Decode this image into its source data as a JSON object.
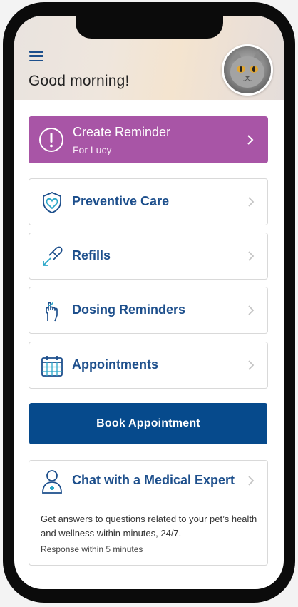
{
  "header": {
    "greeting": "Good morning!",
    "menu_icon": "hamburger-menu-icon",
    "avatar": "pet-avatar-cat"
  },
  "reminder": {
    "title": "Create Reminder",
    "subtitle": "For Lucy",
    "icon": "alert-circle-icon",
    "color": "#a855a6"
  },
  "menu": [
    {
      "label": "Preventive Care",
      "icon": "shield-heart-icon"
    },
    {
      "label": "Refills",
      "icon": "refill-arrows-icon"
    },
    {
      "label": "Dosing Reminders",
      "icon": "finger-string-icon"
    },
    {
      "label": "Appointments",
      "icon": "calendar-icon"
    }
  ],
  "book_button": {
    "label": "Book Appointment",
    "color": "#064a8c"
  },
  "chat": {
    "title": "Chat with a Medical Expert",
    "description": "Get answers to questions related to your pet’s health and wellness within minutes, 24/7.",
    "response_time": "Response within 5 minutes",
    "icon": "person-medical-icon"
  },
  "colors": {
    "accent_blue": "#1d4f8c",
    "icon_teal": "#2aa7c9"
  }
}
